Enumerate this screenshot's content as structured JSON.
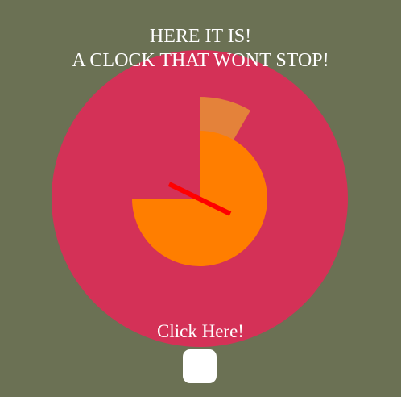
{
  "title": {
    "line1": "HERE IT IS!",
    "line2": "A CLOCK THAT WONT STOP!"
  },
  "action": {
    "label": "Click Here!"
  },
  "clock": {
    "hand_direction": "lower-right / upper-left diagonal",
    "sectors": [
      {
        "name": "outer-orange-sector",
        "color": "#e4823a",
        "start_deg": 0,
        "end_deg": 30
      },
      {
        "name": "inner-orange-sector",
        "color": "#ff7e00",
        "start_deg": 0,
        "end_deg": 270
      }
    ]
  },
  "colors": {
    "background": "#6b7154",
    "clock_face": "#d43157",
    "outer_sector": "#e4823a",
    "inner_sector": "#ff7e00",
    "hand": "#ff0000",
    "text": "#ffffff",
    "button": "#ffffff"
  }
}
